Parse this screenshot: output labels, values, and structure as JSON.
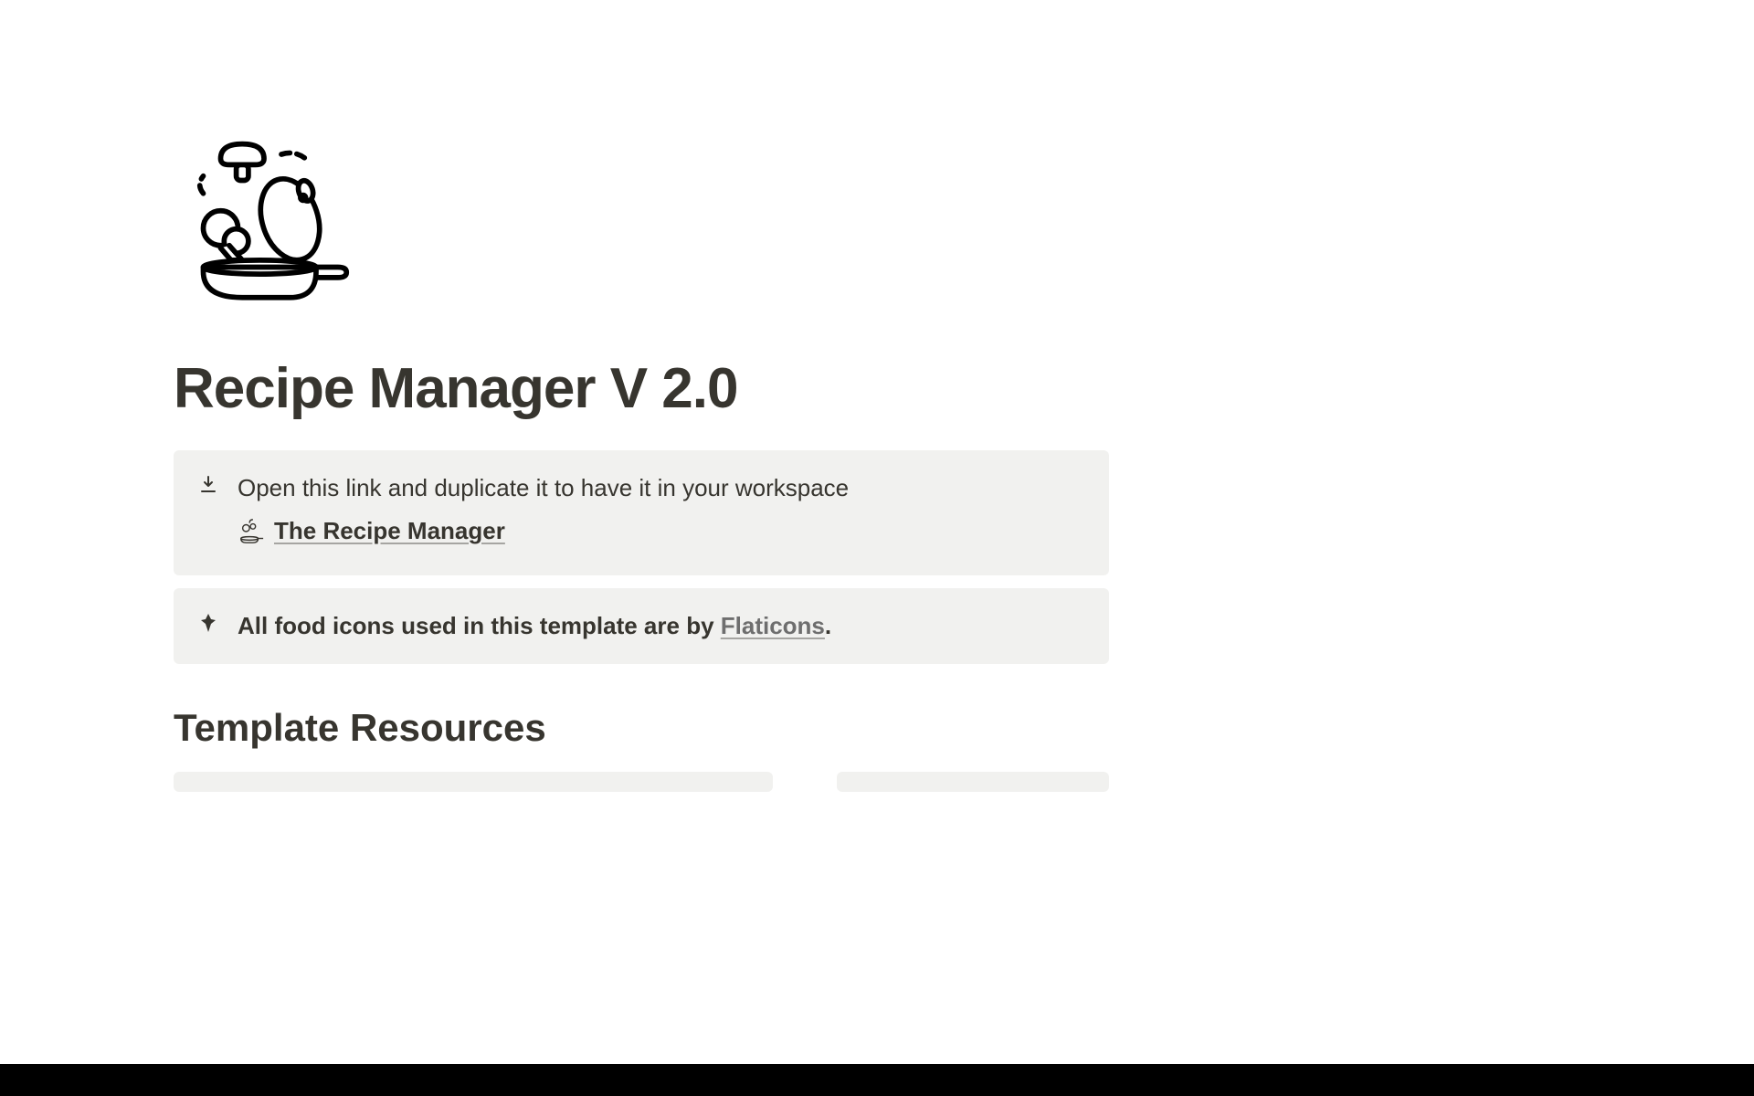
{
  "page": {
    "title": "Recipe Manager V 2.0"
  },
  "callouts": {
    "download": {
      "text": "Open this link and duplicate it to have it in your workspace",
      "link_label": "The Recipe Manager"
    },
    "credit": {
      "text_before": "All food icons used in this template are by ",
      "link_label": "Flaticons",
      "text_after": "."
    }
  },
  "sections": {
    "resources_heading": "Template Resources"
  }
}
